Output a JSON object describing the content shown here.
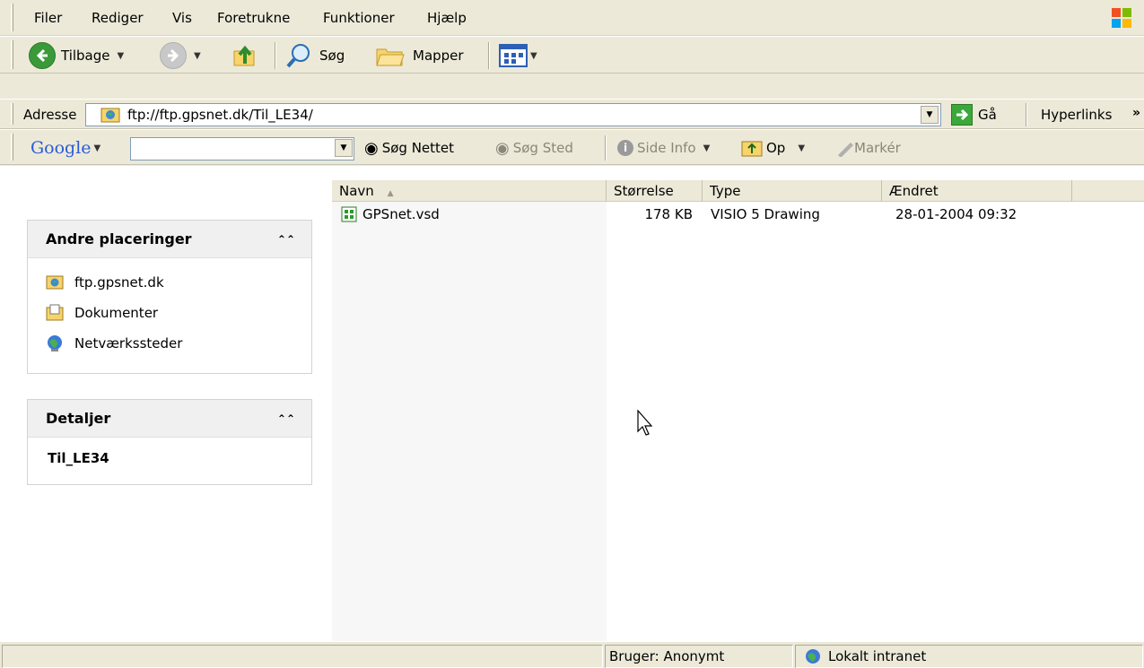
{
  "menu": [
    "Filer",
    "Rediger",
    "Vis",
    "Foretrukne",
    "Funktioner",
    "Hjælp"
  ],
  "toolbar": {
    "back_label": "Tilbage",
    "search_label": "Søg",
    "folders_label": "Mapper"
  },
  "address": {
    "label": "Adresse",
    "url": "ftp://ftp.gpsnet.dk/Til_LE34/",
    "go_label": "Gå",
    "links_label": "Hyperlinks",
    "more": "»"
  },
  "google": {
    "logo": "Google",
    "search_web": "Søg Nettet",
    "search_site": "Søg Sted",
    "page_info": "Side Info",
    "up": "Op",
    "highlight": "Markér"
  },
  "left_pane": {
    "other_places": {
      "title": "Andre placeringer",
      "items": [
        "ftp.gpsnet.dk",
        "Dokumenter",
        "Netværkssteder"
      ]
    },
    "details": {
      "title": "Detaljer",
      "name": "Til_LE34"
    }
  },
  "file_list": {
    "columns": [
      "Navn",
      "Størrelse",
      "Type",
      "Ændret"
    ],
    "rows": [
      {
        "name": "GPSnet.vsd",
        "size": "178 KB",
        "type": "VISIO 5 Drawing",
        "modified": "28-01-2004 09:32"
      }
    ]
  },
  "status": {
    "user": "Bruger: Anonymt",
    "zone": "Lokalt intranet"
  }
}
